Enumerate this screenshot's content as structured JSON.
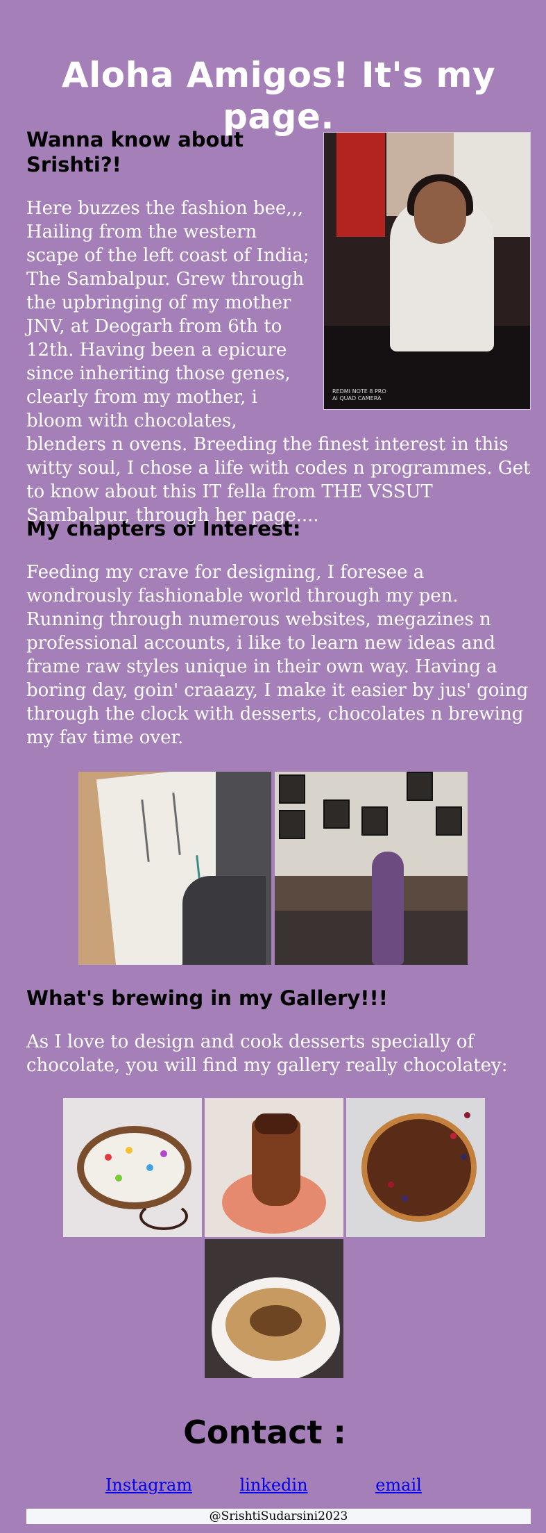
{
  "header": {
    "title": "Aloha Amigos! It's my page."
  },
  "about": {
    "heading": "Wanna know about Srishti?!",
    "text": "Here buzzes the fashion bee,,, Hailing from the western scape of the left coast of India; The Sambalpur. Grew through the upbringing of my mother JNV, at Deogarh from 6th to 12th. Having been a epicure since inheriting those genes, clearly from my mother, i bloom with chocolates, blenders n ovens. Breeding the finest interest in this witty soul, I chose a life with codes n programmes. Get to know about this IT fella from THE VSSUT Sambalpur, through her page....",
    "photo_caption": "REDMI NOTE 8 PRO\nAI QUAD CAMERA"
  },
  "interests": {
    "heading": "My chapters of Interest:",
    "text": "Feeding my crave for designing, I foresee a wondrously fashionable world through my pen. Running through numerous websites, megazines n professional accounts, i like to learn new ideas and frame raw styles unique in their own way. Having a boring day, goin' craaazy, I make it easier by jus' going through the clock with desserts, chocolates n brewing my fav time over."
  },
  "gallery": {
    "heading": "What's brewing in my Gallery!!!",
    "text": "As I love to design and cook desserts specially of chocolate, you will find my gallery really chocolatey:"
  },
  "contact": {
    "heading": "Contact :",
    "links": [
      {
        "label": "Instagram"
      },
      {
        "label": "linkedin"
      },
      {
        "label": "email"
      }
    ]
  },
  "footer": {
    "text": "@SrishtiSudarsini2023"
  },
  "colors": {
    "background": "#a57fb7",
    "link": "#0000ee",
    "footer_bg": "#f5f6fa"
  }
}
